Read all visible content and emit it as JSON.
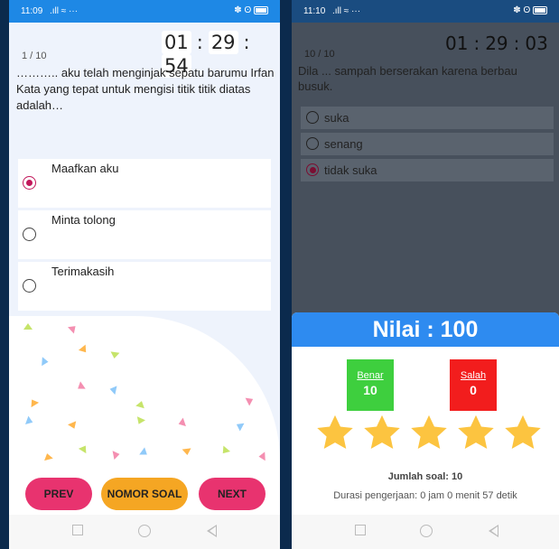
{
  "left_screen": {
    "status": {
      "time": "11:09",
      "signal": ".ıll ≈ ···",
      "right_icons": "✽ ʘ"
    },
    "counter": "1 / 10",
    "timer": {
      "hours": "01",
      "minutes": "29",
      "seconds": "54",
      "separator": ":"
    },
    "question": "……….. aku telah menginjak sepatu barumu Irfan Kata yang tepat untuk mengisi titik titik diatas adalah…",
    "options": [
      {
        "label": "Maafkan aku",
        "selected": true
      },
      {
        "label": "Minta tolong",
        "selected": false
      },
      {
        "label": "Terimakasih",
        "selected": false
      }
    ],
    "buttons": {
      "prev": "PREV",
      "nomor": "NOMOR SOAL",
      "next": "NEXT"
    },
    "colors": {
      "pink": "#e8336f",
      "orange": "#f5a623",
      "accent": "#c2185b"
    }
  },
  "right_screen": {
    "status": {
      "time": "11:10",
      "signal": ".ıll ≈ ···",
      "right_icons": "✽ ʘ"
    },
    "counter": "10 / 10",
    "timer": {
      "hours": "01",
      "minutes": "29",
      "seconds": "03",
      "separator": ":"
    },
    "question": "Dila ... sampah berserakan karena berbau busuk.",
    "options": [
      {
        "label": "suka",
        "selected": false
      },
      {
        "label": "senang",
        "selected": false
      },
      {
        "label": "tidak suka",
        "selected": true
      }
    ],
    "result": {
      "title": "Nilai : 100",
      "benar_label": "Benar",
      "benar_value": "10",
      "salah_label": "Salah",
      "salah_value": "0",
      "stars": 5,
      "jumlah": "Jumlah soal: 10",
      "durasi": "Durasi pengerjaan: 0 jam 0 menit 57 detik",
      "colors": {
        "header": "#2e8bf0",
        "benar": "#3ecf3e",
        "salah": "#f21d1d",
        "star": "#fcc440"
      }
    }
  }
}
